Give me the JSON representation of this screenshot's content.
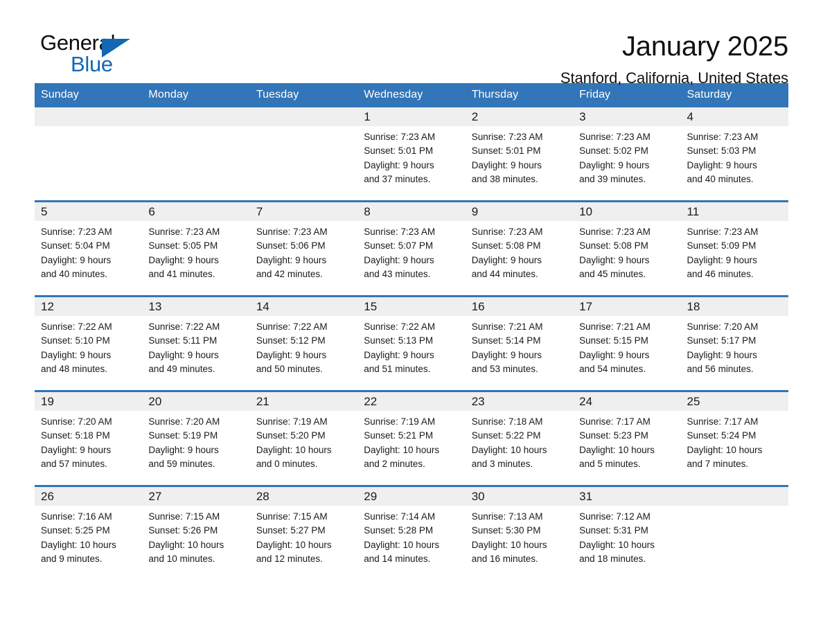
{
  "logo": {
    "word1": "General",
    "word2": "Blue",
    "triangle_color": "#1268b3"
  },
  "header": {
    "month_title": "January 2025",
    "location": "Stanford, California, United States"
  },
  "theme": {
    "header_blue": "#3275b8",
    "daynum_gray": "#efefef",
    "rule_blue": "#3275b8"
  },
  "calendar": {
    "weekday_headers": [
      "Sunday",
      "Monday",
      "Tuesday",
      "Wednesday",
      "Thursday",
      "Friday",
      "Saturday"
    ],
    "weeks": [
      [
        {
          "day": "",
          "empty": true
        },
        {
          "day": "",
          "empty": true
        },
        {
          "day": "",
          "empty": true
        },
        {
          "day": "1",
          "sunrise": "Sunrise: 7:23 AM",
          "sunset": "Sunset: 5:01 PM",
          "daylight_line1": "Daylight: 9 hours",
          "daylight_line2": "and 37 minutes."
        },
        {
          "day": "2",
          "sunrise": "Sunrise: 7:23 AM",
          "sunset": "Sunset: 5:01 PM",
          "daylight_line1": "Daylight: 9 hours",
          "daylight_line2": "and 38 minutes."
        },
        {
          "day": "3",
          "sunrise": "Sunrise: 7:23 AM",
          "sunset": "Sunset: 5:02 PM",
          "daylight_line1": "Daylight: 9 hours",
          "daylight_line2": "and 39 minutes."
        },
        {
          "day": "4",
          "sunrise": "Sunrise: 7:23 AM",
          "sunset": "Sunset: 5:03 PM",
          "daylight_line1": "Daylight: 9 hours",
          "daylight_line2": "and 40 minutes."
        }
      ],
      [
        {
          "day": "5",
          "sunrise": "Sunrise: 7:23 AM",
          "sunset": "Sunset: 5:04 PM",
          "daylight_line1": "Daylight: 9 hours",
          "daylight_line2": "and 40 minutes."
        },
        {
          "day": "6",
          "sunrise": "Sunrise: 7:23 AM",
          "sunset": "Sunset: 5:05 PM",
          "daylight_line1": "Daylight: 9 hours",
          "daylight_line2": "and 41 minutes."
        },
        {
          "day": "7",
          "sunrise": "Sunrise: 7:23 AM",
          "sunset": "Sunset: 5:06 PM",
          "daylight_line1": "Daylight: 9 hours",
          "daylight_line2": "and 42 minutes."
        },
        {
          "day": "8",
          "sunrise": "Sunrise: 7:23 AM",
          "sunset": "Sunset: 5:07 PM",
          "daylight_line1": "Daylight: 9 hours",
          "daylight_line2": "and 43 minutes."
        },
        {
          "day": "9",
          "sunrise": "Sunrise: 7:23 AM",
          "sunset": "Sunset: 5:08 PM",
          "daylight_line1": "Daylight: 9 hours",
          "daylight_line2": "and 44 minutes."
        },
        {
          "day": "10",
          "sunrise": "Sunrise: 7:23 AM",
          "sunset": "Sunset: 5:08 PM",
          "daylight_line1": "Daylight: 9 hours",
          "daylight_line2": "and 45 minutes."
        },
        {
          "day": "11",
          "sunrise": "Sunrise: 7:23 AM",
          "sunset": "Sunset: 5:09 PM",
          "daylight_line1": "Daylight: 9 hours",
          "daylight_line2": "and 46 minutes."
        }
      ],
      [
        {
          "day": "12",
          "sunrise": "Sunrise: 7:22 AM",
          "sunset": "Sunset: 5:10 PM",
          "daylight_line1": "Daylight: 9 hours",
          "daylight_line2": "and 48 minutes."
        },
        {
          "day": "13",
          "sunrise": "Sunrise: 7:22 AM",
          "sunset": "Sunset: 5:11 PM",
          "daylight_line1": "Daylight: 9 hours",
          "daylight_line2": "and 49 minutes."
        },
        {
          "day": "14",
          "sunrise": "Sunrise: 7:22 AM",
          "sunset": "Sunset: 5:12 PM",
          "daylight_line1": "Daylight: 9 hours",
          "daylight_line2": "and 50 minutes."
        },
        {
          "day": "15",
          "sunrise": "Sunrise: 7:22 AM",
          "sunset": "Sunset: 5:13 PM",
          "daylight_line1": "Daylight: 9 hours",
          "daylight_line2": "and 51 minutes."
        },
        {
          "day": "16",
          "sunrise": "Sunrise: 7:21 AM",
          "sunset": "Sunset: 5:14 PM",
          "daylight_line1": "Daylight: 9 hours",
          "daylight_line2": "and 53 minutes."
        },
        {
          "day": "17",
          "sunrise": "Sunrise: 7:21 AM",
          "sunset": "Sunset: 5:15 PM",
          "daylight_line1": "Daylight: 9 hours",
          "daylight_line2": "and 54 minutes."
        },
        {
          "day": "18",
          "sunrise": "Sunrise: 7:20 AM",
          "sunset": "Sunset: 5:17 PM",
          "daylight_line1": "Daylight: 9 hours",
          "daylight_line2": "and 56 minutes."
        }
      ],
      [
        {
          "day": "19",
          "sunrise": "Sunrise: 7:20 AM",
          "sunset": "Sunset: 5:18 PM",
          "daylight_line1": "Daylight: 9 hours",
          "daylight_line2": "and 57 minutes."
        },
        {
          "day": "20",
          "sunrise": "Sunrise: 7:20 AM",
          "sunset": "Sunset: 5:19 PM",
          "daylight_line1": "Daylight: 9 hours",
          "daylight_line2": "and 59 minutes."
        },
        {
          "day": "21",
          "sunrise": "Sunrise: 7:19 AM",
          "sunset": "Sunset: 5:20 PM",
          "daylight_line1": "Daylight: 10 hours",
          "daylight_line2": "and 0 minutes."
        },
        {
          "day": "22",
          "sunrise": "Sunrise: 7:19 AM",
          "sunset": "Sunset: 5:21 PM",
          "daylight_line1": "Daylight: 10 hours",
          "daylight_line2": "and 2 minutes."
        },
        {
          "day": "23",
          "sunrise": "Sunrise: 7:18 AM",
          "sunset": "Sunset: 5:22 PM",
          "daylight_line1": "Daylight: 10 hours",
          "daylight_line2": "and 3 minutes."
        },
        {
          "day": "24",
          "sunrise": "Sunrise: 7:17 AM",
          "sunset": "Sunset: 5:23 PM",
          "daylight_line1": "Daylight: 10 hours",
          "daylight_line2": "and 5 minutes."
        },
        {
          "day": "25",
          "sunrise": "Sunrise: 7:17 AM",
          "sunset": "Sunset: 5:24 PM",
          "daylight_line1": "Daylight: 10 hours",
          "daylight_line2": "and 7 minutes."
        }
      ],
      [
        {
          "day": "26",
          "sunrise": "Sunrise: 7:16 AM",
          "sunset": "Sunset: 5:25 PM",
          "daylight_line1": "Daylight: 10 hours",
          "daylight_line2": "and 9 minutes."
        },
        {
          "day": "27",
          "sunrise": "Sunrise: 7:15 AM",
          "sunset": "Sunset: 5:26 PM",
          "daylight_line1": "Daylight: 10 hours",
          "daylight_line2": "and 10 minutes."
        },
        {
          "day": "28",
          "sunrise": "Sunrise: 7:15 AM",
          "sunset": "Sunset: 5:27 PM",
          "daylight_line1": "Daylight: 10 hours",
          "daylight_line2": "and 12 minutes."
        },
        {
          "day": "29",
          "sunrise": "Sunrise: 7:14 AM",
          "sunset": "Sunset: 5:28 PM",
          "daylight_line1": "Daylight: 10 hours",
          "daylight_line2": "and 14 minutes."
        },
        {
          "day": "30",
          "sunrise": "Sunrise: 7:13 AM",
          "sunset": "Sunset: 5:30 PM",
          "daylight_line1": "Daylight: 10 hours",
          "daylight_line2": "and 16 minutes."
        },
        {
          "day": "31",
          "sunrise": "Sunrise: 7:12 AM",
          "sunset": "Sunset: 5:31 PM",
          "daylight_line1": "Daylight: 10 hours",
          "daylight_line2": "and 18 minutes."
        },
        {
          "day": "",
          "empty": true
        }
      ]
    ]
  }
}
